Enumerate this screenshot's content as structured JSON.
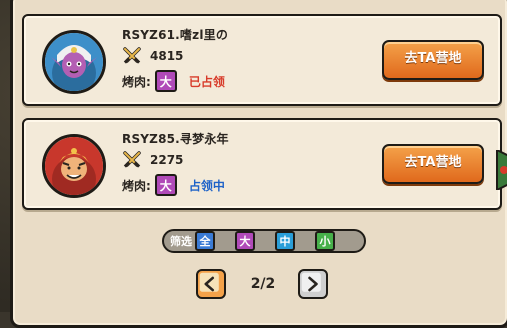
{
  "players": [
    {
      "name": "RSYZ61.嗜zl里の",
      "power": "4815",
      "bbq_label": "烤肉:",
      "size": "大",
      "status": "已占领",
      "status_color": "#d83b2a",
      "action": "去TA营地",
      "avatar": "elf-avatar-icon"
    },
    {
      "name": "RSYZ85.寻梦永年",
      "power": "2275",
      "bbq_label": "烤肉:",
      "size": "大",
      "status": "占领中",
      "status_color": "#1f63c8",
      "action": "去TA营地",
      "avatar": "monk-avatar-icon"
    }
  ],
  "filter": {
    "label": "筛选",
    "options": [
      {
        "label": "全",
        "color": "#3a7bd5"
      },
      {
        "label": "大",
        "color": "#b04ab8"
      },
      {
        "label": "中",
        "color": "#2a9ed8"
      },
      {
        "label": "小",
        "color": "#46b04a"
      }
    ]
  },
  "pager": {
    "text": "2/2"
  },
  "colors": {
    "accent": "#e0691c",
    "panel": "#e9dcc6"
  }
}
